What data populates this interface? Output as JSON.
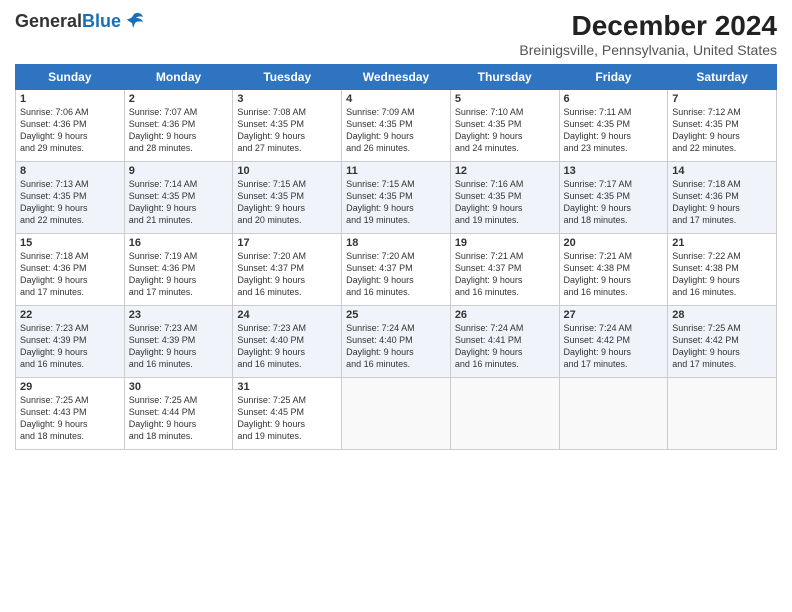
{
  "header": {
    "logo_general": "General",
    "logo_blue": "Blue",
    "title": "December 2024",
    "subtitle": "Breinigsville, Pennsylvania, United States"
  },
  "columns": [
    "Sunday",
    "Monday",
    "Tuesday",
    "Wednesday",
    "Thursday",
    "Friday",
    "Saturday"
  ],
  "weeks": [
    [
      {
        "day": "1",
        "lines": [
          "Sunrise: 7:06 AM",
          "Sunset: 4:36 PM",
          "Daylight: 9 hours",
          "and 29 minutes."
        ]
      },
      {
        "day": "2",
        "lines": [
          "Sunrise: 7:07 AM",
          "Sunset: 4:36 PM",
          "Daylight: 9 hours",
          "and 28 minutes."
        ]
      },
      {
        "day": "3",
        "lines": [
          "Sunrise: 7:08 AM",
          "Sunset: 4:35 PM",
          "Daylight: 9 hours",
          "and 27 minutes."
        ]
      },
      {
        "day": "4",
        "lines": [
          "Sunrise: 7:09 AM",
          "Sunset: 4:35 PM",
          "Daylight: 9 hours",
          "and 26 minutes."
        ]
      },
      {
        "day": "5",
        "lines": [
          "Sunrise: 7:10 AM",
          "Sunset: 4:35 PM",
          "Daylight: 9 hours",
          "and 24 minutes."
        ]
      },
      {
        "day": "6",
        "lines": [
          "Sunrise: 7:11 AM",
          "Sunset: 4:35 PM",
          "Daylight: 9 hours",
          "and 23 minutes."
        ]
      },
      {
        "day": "7",
        "lines": [
          "Sunrise: 7:12 AM",
          "Sunset: 4:35 PM",
          "Daylight: 9 hours",
          "and 22 minutes."
        ]
      }
    ],
    [
      {
        "day": "8",
        "lines": [
          "Sunrise: 7:13 AM",
          "Sunset: 4:35 PM",
          "Daylight: 9 hours",
          "and 22 minutes."
        ]
      },
      {
        "day": "9",
        "lines": [
          "Sunrise: 7:14 AM",
          "Sunset: 4:35 PM",
          "Daylight: 9 hours",
          "and 21 minutes."
        ]
      },
      {
        "day": "10",
        "lines": [
          "Sunrise: 7:15 AM",
          "Sunset: 4:35 PM",
          "Daylight: 9 hours",
          "and 20 minutes."
        ]
      },
      {
        "day": "11",
        "lines": [
          "Sunrise: 7:15 AM",
          "Sunset: 4:35 PM",
          "Daylight: 9 hours",
          "and 19 minutes."
        ]
      },
      {
        "day": "12",
        "lines": [
          "Sunrise: 7:16 AM",
          "Sunset: 4:35 PM",
          "Daylight: 9 hours",
          "and 19 minutes."
        ]
      },
      {
        "day": "13",
        "lines": [
          "Sunrise: 7:17 AM",
          "Sunset: 4:35 PM",
          "Daylight: 9 hours",
          "and 18 minutes."
        ]
      },
      {
        "day": "14",
        "lines": [
          "Sunrise: 7:18 AM",
          "Sunset: 4:36 PM",
          "Daylight: 9 hours",
          "and 17 minutes."
        ]
      }
    ],
    [
      {
        "day": "15",
        "lines": [
          "Sunrise: 7:18 AM",
          "Sunset: 4:36 PM",
          "Daylight: 9 hours",
          "and 17 minutes."
        ]
      },
      {
        "day": "16",
        "lines": [
          "Sunrise: 7:19 AM",
          "Sunset: 4:36 PM",
          "Daylight: 9 hours",
          "and 17 minutes."
        ]
      },
      {
        "day": "17",
        "lines": [
          "Sunrise: 7:20 AM",
          "Sunset: 4:37 PM",
          "Daylight: 9 hours",
          "and 16 minutes."
        ]
      },
      {
        "day": "18",
        "lines": [
          "Sunrise: 7:20 AM",
          "Sunset: 4:37 PM",
          "Daylight: 9 hours",
          "and 16 minutes."
        ]
      },
      {
        "day": "19",
        "lines": [
          "Sunrise: 7:21 AM",
          "Sunset: 4:37 PM",
          "Daylight: 9 hours",
          "and 16 minutes."
        ]
      },
      {
        "day": "20",
        "lines": [
          "Sunrise: 7:21 AM",
          "Sunset: 4:38 PM",
          "Daylight: 9 hours",
          "and 16 minutes."
        ]
      },
      {
        "day": "21",
        "lines": [
          "Sunrise: 7:22 AM",
          "Sunset: 4:38 PM",
          "Daylight: 9 hours",
          "and 16 minutes."
        ]
      }
    ],
    [
      {
        "day": "22",
        "lines": [
          "Sunrise: 7:23 AM",
          "Sunset: 4:39 PM",
          "Daylight: 9 hours",
          "and 16 minutes."
        ]
      },
      {
        "day": "23",
        "lines": [
          "Sunrise: 7:23 AM",
          "Sunset: 4:39 PM",
          "Daylight: 9 hours",
          "and 16 minutes."
        ]
      },
      {
        "day": "24",
        "lines": [
          "Sunrise: 7:23 AM",
          "Sunset: 4:40 PM",
          "Daylight: 9 hours",
          "and 16 minutes."
        ]
      },
      {
        "day": "25",
        "lines": [
          "Sunrise: 7:24 AM",
          "Sunset: 4:40 PM",
          "Daylight: 9 hours",
          "and 16 minutes."
        ]
      },
      {
        "day": "26",
        "lines": [
          "Sunrise: 7:24 AM",
          "Sunset: 4:41 PM",
          "Daylight: 9 hours",
          "and 16 minutes."
        ]
      },
      {
        "day": "27",
        "lines": [
          "Sunrise: 7:24 AM",
          "Sunset: 4:42 PM",
          "Daylight: 9 hours",
          "and 17 minutes."
        ]
      },
      {
        "day": "28",
        "lines": [
          "Sunrise: 7:25 AM",
          "Sunset: 4:42 PM",
          "Daylight: 9 hours",
          "and 17 minutes."
        ]
      }
    ],
    [
      {
        "day": "29",
        "lines": [
          "Sunrise: 7:25 AM",
          "Sunset: 4:43 PM",
          "Daylight: 9 hours",
          "and 18 minutes."
        ]
      },
      {
        "day": "30",
        "lines": [
          "Sunrise: 7:25 AM",
          "Sunset: 4:44 PM",
          "Daylight: 9 hours",
          "and 18 minutes."
        ]
      },
      {
        "day": "31",
        "lines": [
          "Sunrise: 7:25 AM",
          "Sunset: 4:45 PM",
          "Daylight: 9 hours",
          "and 19 minutes."
        ]
      },
      null,
      null,
      null,
      null
    ]
  ]
}
